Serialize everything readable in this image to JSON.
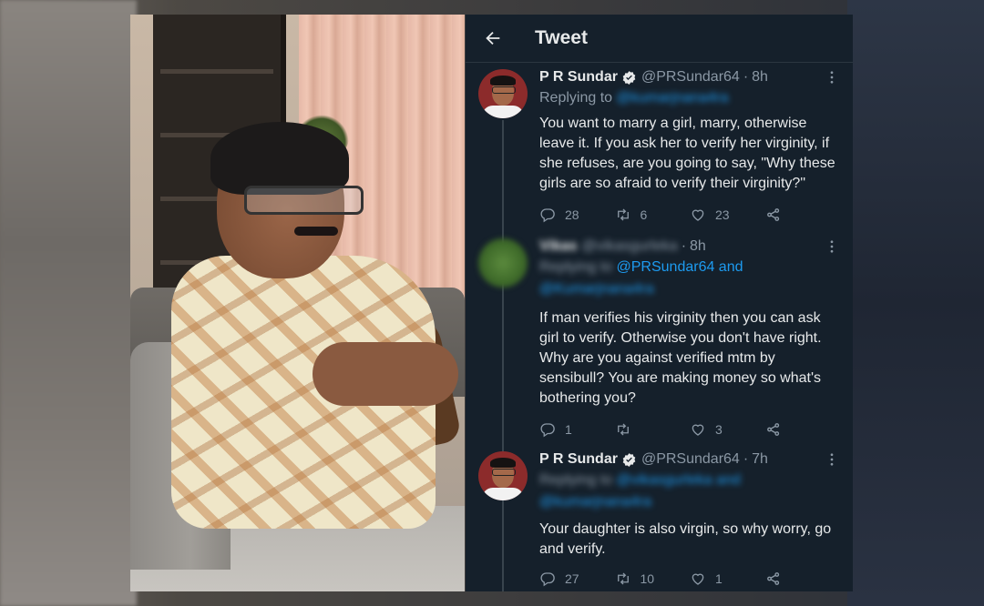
{
  "header": {
    "title": "Tweet"
  },
  "tweets": [
    {
      "name": "P R Sundar",
      "handle": "@PRSundar64",
      "time": "8h",
      "replying_label": "Replying to",
      "replying_to": "@kumarjnana4ra",
      "text": "You want to marry a girl, marry, otherwise leave it. If you ask her to verify her virginity, if she refuses, are you going to say, \"Why these girls are so afraid to verify their virginity?\"",
      "replies": "28",
      "retweets": "6",
      "likes": "23"
    },
    {
      "name": "Vikas",
      "handle": "@vikasgurleka",
      "time": "8h",
      "replying_label": "Replying to",
      "replying_visible": "@PRSundar64 and",
      "replying_second": "@Kumarjnana4ra",
      "text": "If man verifies his virginity then you can ask girl to verify. Otherwise you don't have right. Why are you against verified mtm by sensibull? You are making money so what's bothering you?",
      "replies": "1",
      "retweets": "",
      "likes": "3"
    },
    {
      "name": "P R Sundar",
      "handle": "@PRSundar64",
      "time": "7h",
      "replying_label": "Replying to",
      "replying_to": "@vikasgurleka and",
      "replying_second": "@kumarjnana4ra",
      "text": "Your daughter is also virgin, so why worry, go and verify.",
      "replies": "27",
      "retweets": "10",
      "likes": "1"
    }
  ]
}
